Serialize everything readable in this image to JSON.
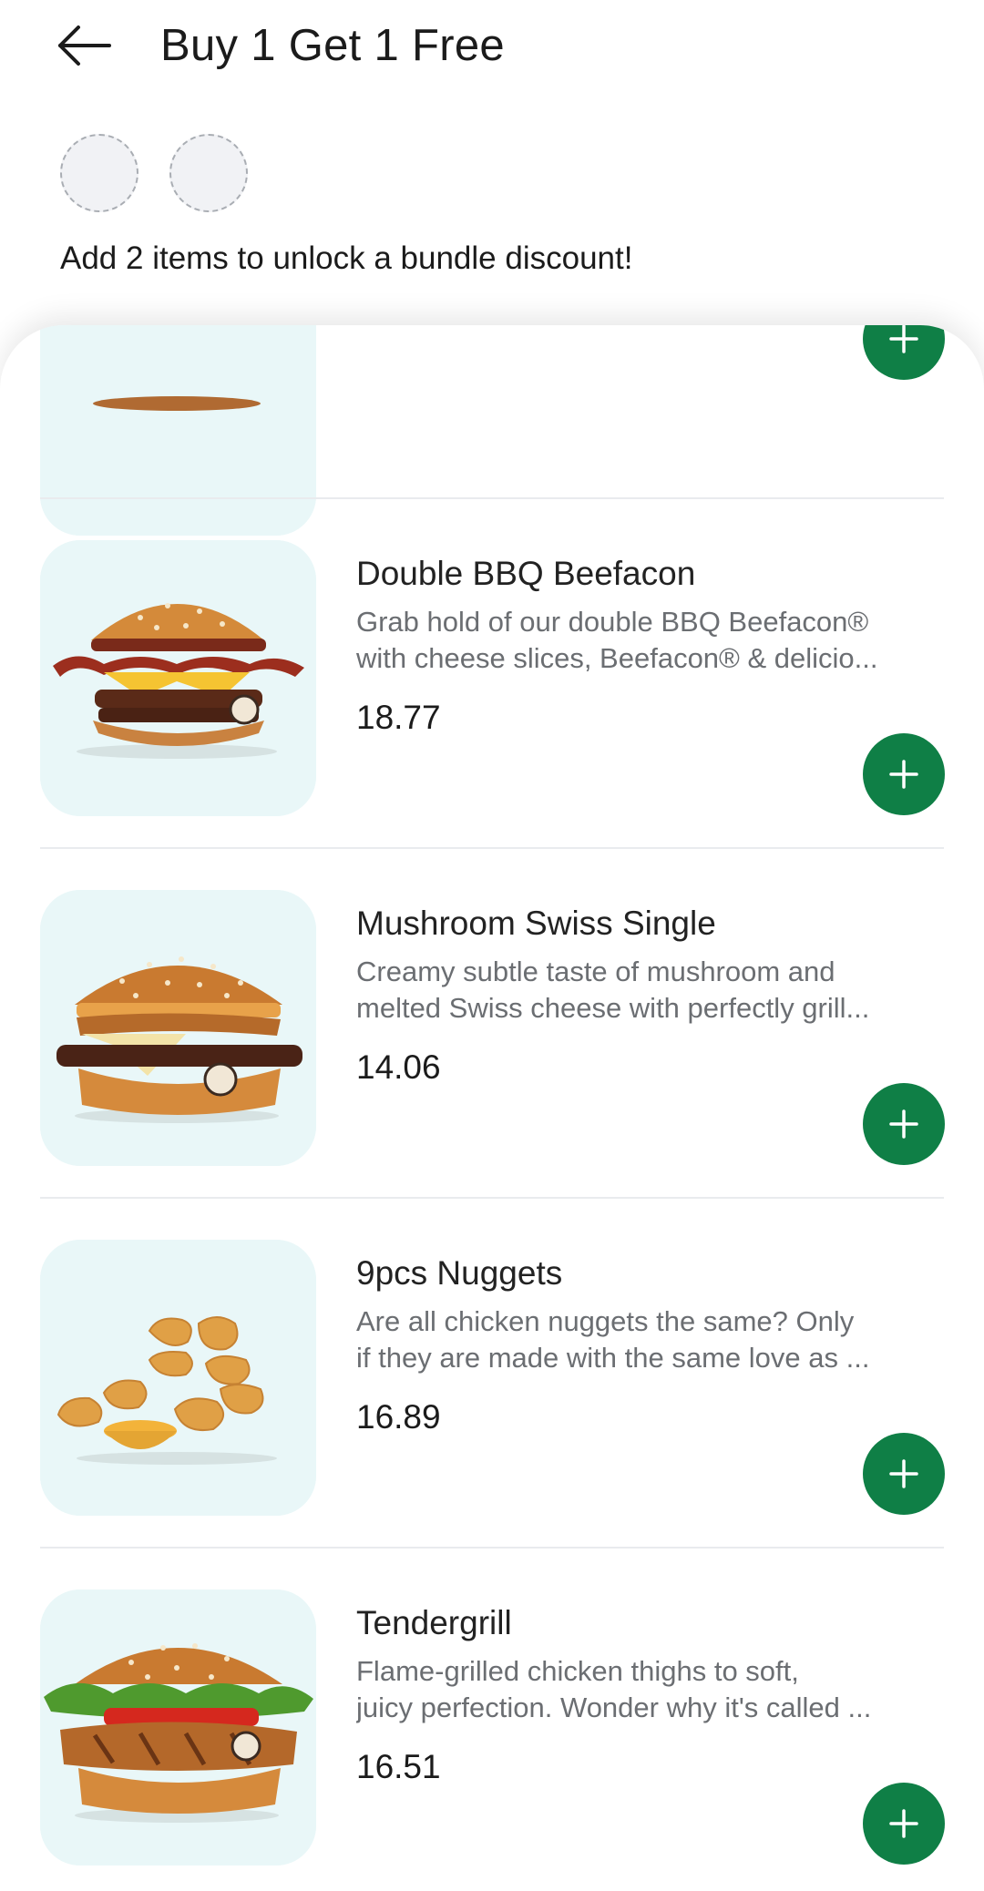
{
  "header": {
    "title": "Buy 1 Get 1 Free"
  },
  "bundle": {
    "message": "Add 2 items to unlock a bundle discount!"
  },
  "items": [
    {
      "name": "Double BBQ Beefacon",
      "desc1": "Grab hold of our double BBQ Beefacon®",
      "desc2": "with cheese slices, Beefacon® & delicio...",
      "price": "18.77",
      "image": "double-bbq-beefacon-image"
    },
    {
      "name": "Mushroom Swiss Single",
      "desc1": "Creamy subtle taste of mushroom and",
      "desc2": "melted Swiss cheese with perfectly grill...",
      "price": "14.06",
      "image": "mushroom-swiss-image"
    },
    {
      "name": "9pcs Nuggets",
      "desc1": "Are all chicken nuggets the same? Only",
      "desc2": "if they are made with the same love as ...",
      "price": "16.89",
      "image": "nuggets-image"
    },
    {
      "name": "Tendergrill",
      "desc1": "Flame-grilled chicken thighs to soft,",
      "desc2": "juicy perfection. Wonder why it's called ...",
      "price": "16.51",
      "image": "tendergrill-image"
    }
  ],
  "colors": {
    "accent": "#0f7f46",
    "thumb_bg": "#e9f7f8"
  },
  "icons": {
    "back": "arrow-left-icon",
    "add": "plus-icon"
  }
}
